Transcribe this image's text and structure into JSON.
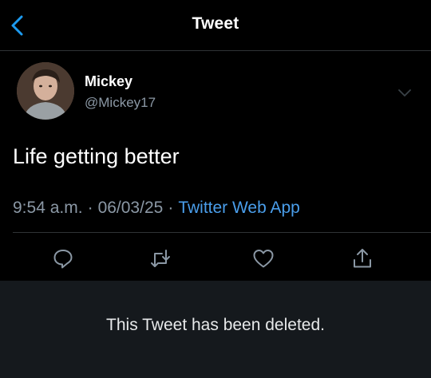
{
  "header": {
    "title": "Tweet",
    "back_icon": "chevron-left-icon"
  },
  "tweet": {
    "author_name": "Mickey",
    "author_handle": "@Mickey17",
    "text": "Life getting better",
    "time": "9:54 a.m.",
    "date": "06/03/25",
    "separator": "·",
    "source": "Twitter Web App"
  },
  "actions": {
    "reply_icon": "reply-icon",
    "retweet_icon": "retweet-icon",
    "like_icon": "heart-icon",
    "share_icon": "share-icon"
  },
  "notice": {
    "text": "This Tweet has been deleted."
  },
  "colors": {
    "background": "#000000",
    "accent": "#4a9eeb",
    "muted": "#8b98a5",
    "panel": "#15191d"
  }
}
